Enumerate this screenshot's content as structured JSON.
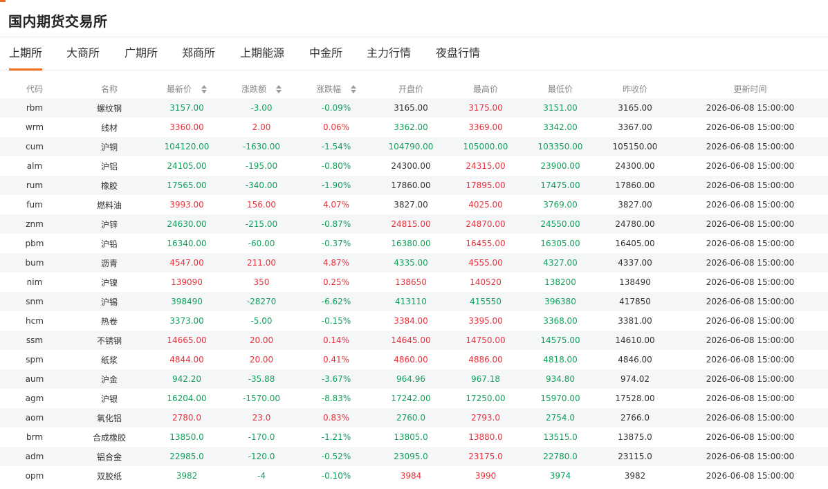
{
  "header": {
    "title": "国内期货交易所"
  },
  "tabs": [
    {
      "label": "上期所",
      "active": true
    },
    {
      "label": "大商所",
      "active": false
    },
    {
      "label": "广期所",
      "active": false
    },
    {
      "label": "郑商所",
      "active": false
    },
    {
      "label": "上期能源",
      "active": false
    },
    {
      "label": "中金所",
      "active": false
    },
    {
      "label": "主力行情",
      "active": false
    },
    {
      "label": "夜盘行情",
      "active": false
    }
  ],
  "table": {
    "columns": [
      "代码",
      "名称",
      "最新价",
      "涨跌额",
      "涨跌幅",
      "开盘价",
      "最高价",
      "最低价",
      "昨收价",
      "更新时间"
    ],
    "sortable_columns": [
      "最新价",
      "涨跌额",
      "涨跌幅"
    ],
    "colors": {
      "up": "#e8323c",
      "down": "#12a05c",
      "flat": "#333333"
    },
    "rows": [
      [
        "rbm",
        "螺纹钢",
        "3157.00",
        "-3.00",
        "-0.09%",
        "3165.00",
        "3175.00",
        "3151.00",
        "3165.00",
        "2026-06-08 15:00:00"
      ],
      [
        "wrm",
        "线材",
        "3360.00",
        "2.00",
        "0.06%",
        "3362.00",
        "3369.00",
        "3342.00",
        "3367.00",
        "2026-06-08 15:00:00"
      ],
      [
        "cum",
        "沪铜",
        "104120.00",
        "-1630.00",
        "-1.54%",
        "104790.00",
        "105000.00",
        "103350.00",
        "105150.00",
        "2026-06-08 15:00:00"
      ],
      [
        "alm",
        "沪铝",
        "24105.00",
        "-195.00",
        "-0.80%",
        "24300.00",
        "24315.00",
        "23900.00",
        "24300.00",
        "2026-06-08 15:00:00"
      ],
      [
        "rum",
        "橡胶",
        "17565.00",
        "-340.00",
        "-1.90%",
        "17860.00",
        "17895.00",
        "17475.00",
        "17860.00",
        "2026-06-08 15:00:00"
      ],
      [
        "fum",
        "燃料油",
        "3993.00",
        "156.00",
        "4.07%",
        "3827.00",
        "4025.00",
        "3769.00",
        "3827.00",
        "2026-06-08 15:00:00"
      ],
      [
        "znm",
        "沪锌",
        "24630.00",
        "-215.00",
        "-0.87%",
        "24815.00",
        "24870.00",
        "24550.00",
        "24780.00",
        "2026-06-08 15:00:00"
      ],
      [
        "pbm",
        "沪铅",
        "16340.00",
        "-60.00",
        "-0.37%",
        "16380.00",
        "16455.00",
        "16305.00",
        "16405.00",
        "2026-06-08 15:00:00"
      ],
      [
        "bum",
        "沥青",
        "4547.00",
        "211.00",
        "4.87%",
        "4335.00",
        "4555.00",
        "4327.00",
        "4337.00",
        "2026-06-08 15:00:00"
      ],
      [
        "nim",
        "沪镍",
        "139090",
        "350",
        "0.25%",
        "138650",
        "140520",
        "138200",
        "138490",
        "2026-06-08 15:00:00"
      ],
      [
        "snm",
        "沪锡",
        "398490",
        "-28270",
        "-6.62%",
        "413110",
        "415550",
        "396380",
        "417850",
        "2026-06-08 15:00:00"
      ],
      [
        "hcm",
        "热卷",
        "3373.00",
        "-5.00",
        "-0.15%",
        "3384.00",
        "3395.00",
        "3368.00",
        "3381.00",
        "2026-06-08 15:00:00"
      ],
      [
        "ssm",
        "不锈钢",
        "14665.00",
        "20.00",
        "0.14%",
        "14645.00",
        "14750.00",
        "14575.00",
        "14610.00",
        "2026-06-08 15:00:00"
      ],
      [
        "spm",
        "纸浆",
        "4844.00",
        "20.00",
        "0.41%",
        "4860.00",
        "4886.00",
        "4818.00",
        "4846.00",
        "2026-06-08 15:00:00"
      ],
      [
        "aum",
        "沪金",
        "942.20",
        "-35.88",
        "-3.67%",
        "964.96",
        "967.18",
        "934.80",
        "974.02",
        "2026-06-08 15:00:00"
      ],
      [
        "agm",
        "沪银",
        "16204.00",
        "-1570.00",
        "-8.83%",
        "17242.00",
        "17250.00",
        "15970.00",
        "17528.00",
        "2026-06-08 15:00:00"
      ],
      [
        "aom",
        "氧化铝",
        "2780.0",
        "23.0",
        "0.83%",
        "2760.0",
        "2793.0",
        "2754.0",
        "2766.0",
        "2026-06-08 15:00:00"
      ],
      [
        "brm",
        "合成橡胶",
        "13850.0",
        "-170.0",
        "-1.21%",
        "13805.0",
        "13880.0",
        "13515.0",
        "13875.0",
        "2026-06-08 15:00:00"
      ],
      [
        "adm",
        "铝合金",
        "22985.0",
        "-120.0",
        "-0.52%",
        "23095.0",
        "23175.0",
        "22780.0",
        "23115.0",
        "2026-06-08 15:00:00"
      ],
      [
        "opm",
        "双胶纸",
        "3982",
        "-4",
        "-0.10%",
        "3984",
        "3990",
        "3974",
        "3982",
        "2026-06-08 15:00:00"
      ]
    ]
  }
}
